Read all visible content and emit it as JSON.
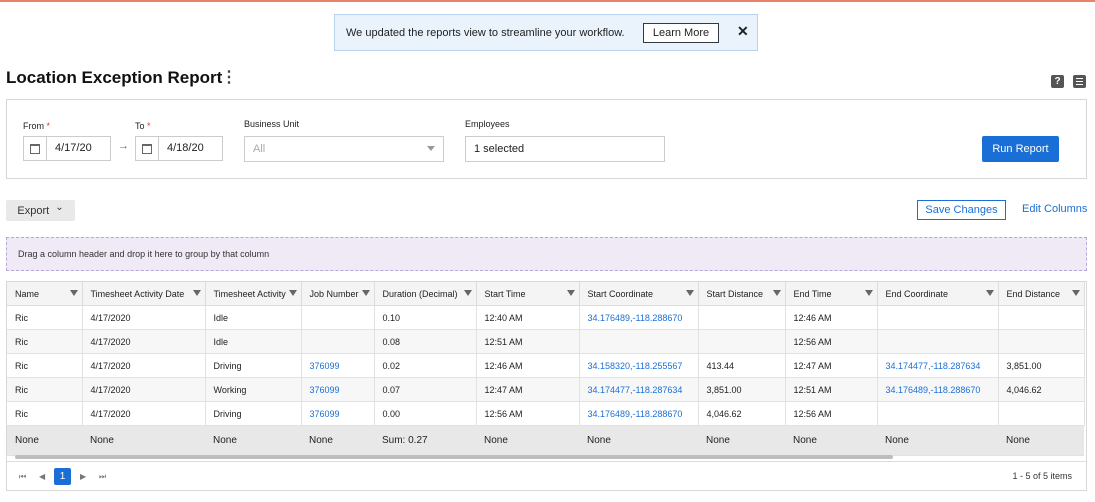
{
  "banner": {
    "message": "We updated the reports view to streamline your workflow.",
    "learn_more": "Learn More",
    "close": "✕"
  },
  "page": {
    "title": "Location Exception Report",
    "kebab": "⋮",
    "help": "?"
  },
  "filters": {
    "from_label": "From",
    "to_label": "To",
    "required_mark": "*",
    "from_value": "4/17/20",
    "to_value": "4/18/20",
    "arrow": "→",
    "business_unit_label": "Business Unit",
    "business_unit_placeholder": "All",
    "employees_label": "Employees",
    "employees_value": "1 selected",
    "run_report": "Run Report"
  },
  "toolbar": {
    "export": "Export",
    "export_caret": "⌄",
    "save_changes": "Save Changes",
    "edit_columns": "Edit Columns"
  },
  "group_panel": "Drag a column header and drop it here to group by that column",
  "grid": {
    "columns": [
      "Name",
      "Timesheet Activity Date",
      "Timesheet Activity",
      "Job Number",
      "Duration (Decimal)",
      "Start Time",
      "Start Coordinate",
      "Start Distance",
      "End Time",
      "End Coordinate",
      "End Distance"
    ],
    "rows": [
      [
        "Ric",
        "4/17/2020",
        "Idle",
        "",
        "0.10",
        "12:40 AM",
        "34.176489,-118.288670",
        "",
        "12:46 AM",
        "",
        ""
      ],
      [
        "Ric",
        "4/17/2020",
        "Idle",
        "",
        "0.08",
        "12:51 AM",
        "",
        "",
        "12:56 AM",
        "",
        ""
      ],
      [
        "Ric",
        "4/17/2020",
        "Driving",
        "376099",
        "0.02",
        "12:46 AM",
        "34.158320,-118.255567",
        "413.44",
        "12:47 AM",
        "34.174477,-118.287634",
        "3,851.00"
      ],
      [
        "Ric",
        "4/17/2020",
        "Working",
        "376099",
        "0.07",
        "12:47 AM",
        "34.174477,-118.287634",
        "3,851.00",
        "12:51 AM",
        "34.176489,-118.288670",
        "4,046.62"
      ],
      [
        "Ric",
        "4/17/2020",
        "Driving",
        "376099",
        "0.00",
        "12:56 AM",
        "34.176489,-118.288670",
        "4,046.62",
        "12:56 AM",
        "",
        ""
      ]
    ],
    "aggregates": [
      "None",
      "None",
      "None",
      "None",
      "Sum: 0.27",
      "None",
      "None",
      "None",
      "None",
      "None",
      "None"
    ]
  },
  "pager": {
    "first": "⏮",
    "prev": "◀",
    "page": "1",
    "next": "▶",
    "last": "⏭",
    "items_info": "1 - 5 of 5 items"
  },
  "colors": {
    "accent": "#1a6fd6",
    "top_line": "#e8836b",
    "banner_bg": "#eaf2fb",
    "group_panel_bg": "#efeaf6"
  }
}
